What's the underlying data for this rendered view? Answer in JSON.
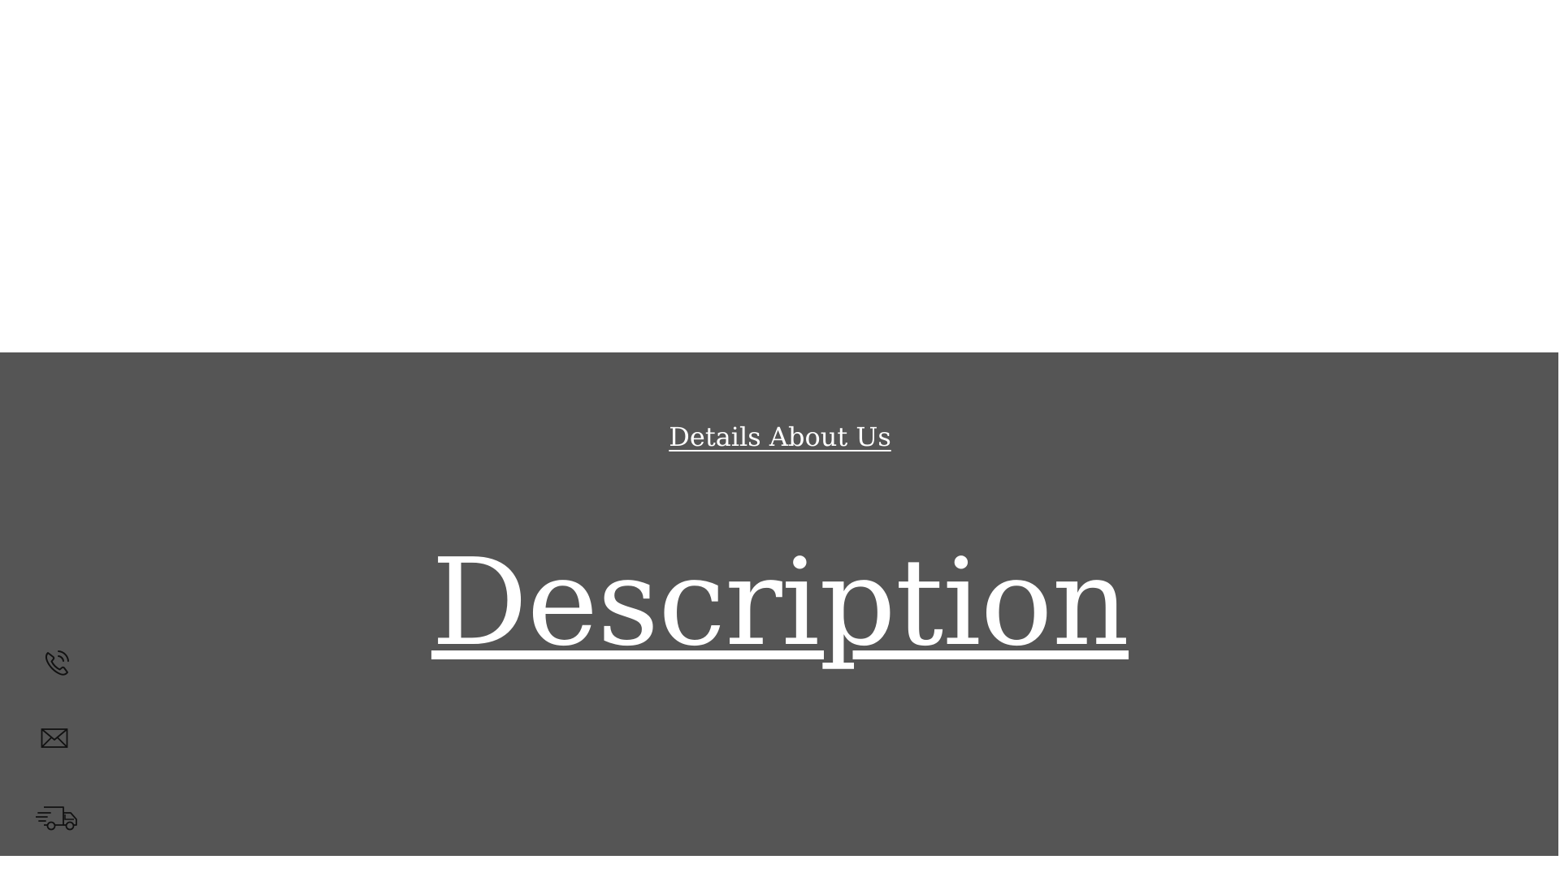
{
  "colors": {
    "section_background": "#555555",
    "text": "#ffffff",
    "icon_stroke": "#111111",
    "page_background": "#ffffff"
  },
  "section": {
    "link_label": "Details About Us",
    "heading": "Description"
  },
  "icons": [
    "phone-icon",
    "mail-icon",
    "delivery-truck-icon"
  ]
}
